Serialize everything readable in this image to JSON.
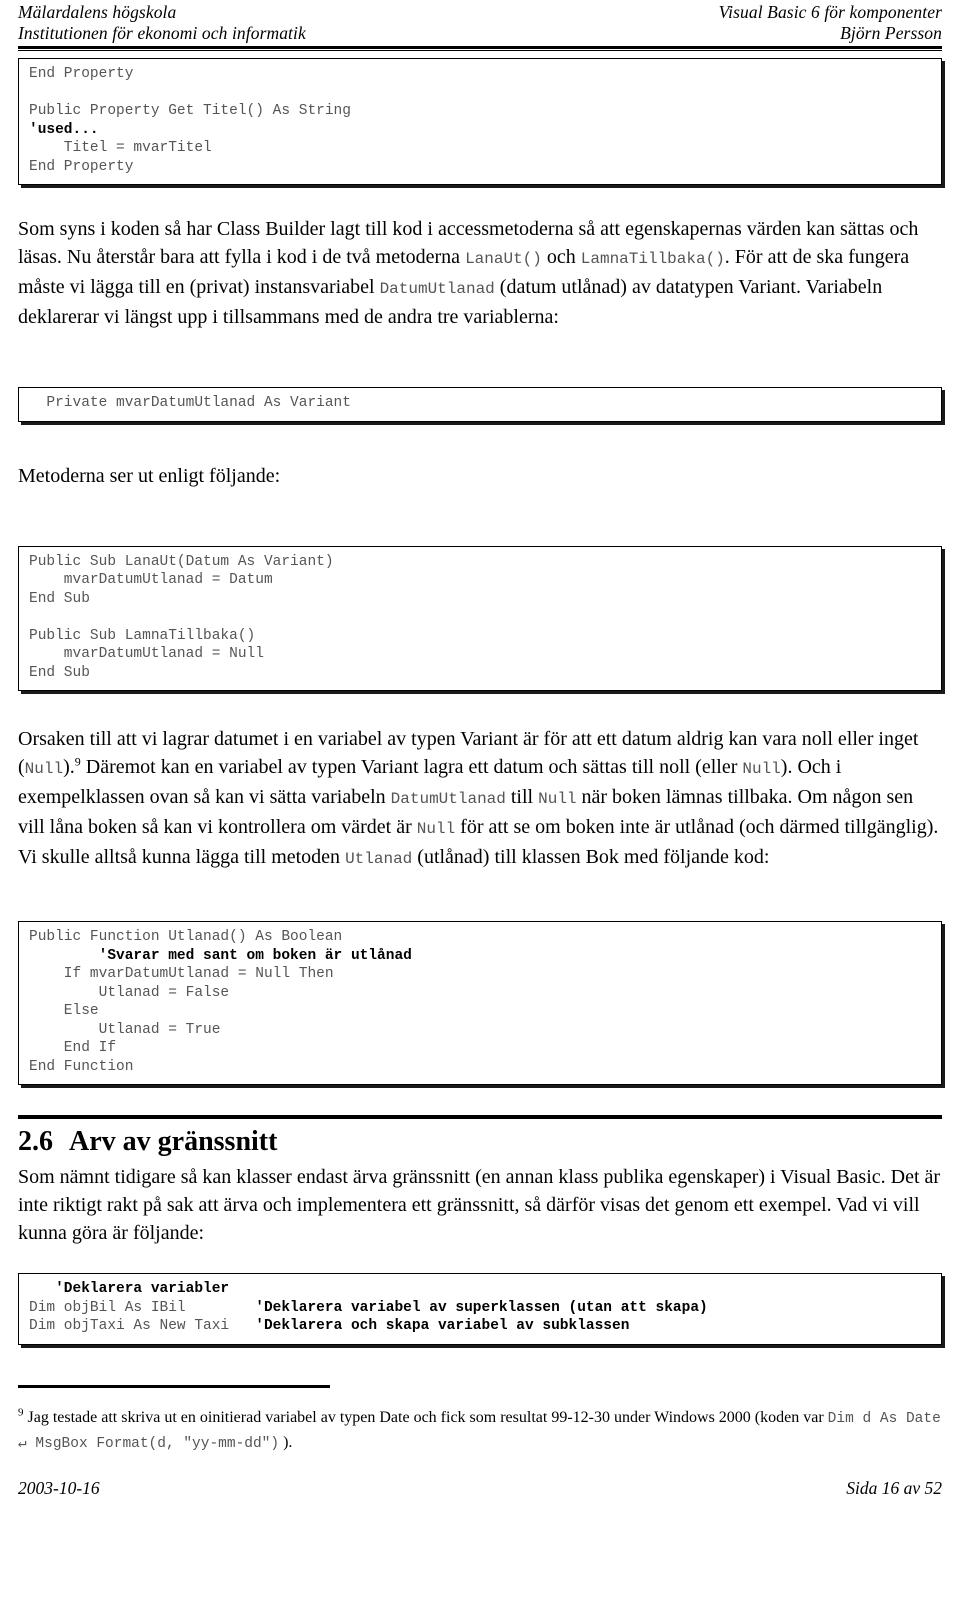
{
  "header": {
    "left_line1": "Mälardalens högskola",
    "left_line2": "Institutionen för ekonomi och informatik",
    "right_line1": "Visual Basic 6 för komponenter",
    "right_line2": "Björn Persson"
  },
  "code_blocks": {
    "block1_pre": "End Property\n\nPublic Property Get Titel() As String\n",
    "block1_bold": "'used...",
    "block1_post": "\n    Titel = mvarTitel\nEnd Property",
    "block2": "  Private mvarDatumUtlanad As Variant",
    "block3": "Public Sub LanaUt(Datum As Variant)\n    mvarDatumUtlanad = Datum\nEnd Sub\n\nPublic Sub LamnaTillbaka()\n    mvarDatumUtlanad = Null\nEnd Sub",
    "block4_l1": "Public Function Utlanad() As Boolean",
    "block4_l2_bold": "        'Svarar med sant om boken är utlånad",
    "block4_rest": "    If mvarDatumUtlanad = Null Then\n        Utlanad = False\n    Else\n        Utlanad = True\n    End If\nEnd Function",
    "block5_l1_bold": "   'Deklarera variabler",
    "block5_l2_code": "Dim objBil As IBil        ",
    "block5_l2_bold": "'Deklarera variabel av superklassen (utan att skapa)",
    "block5_l3_code": "Dim objTaxi As New Taxi   ",
    "block5_l3_bold": "'Deklarera och skapa variabel av subklassen"
  },
  "paragraphs": {
    "p1_a": "Som syns i koden så har Class Builder lagt till kod i accessmetoderna så att egenskapernas värden kan sättas och läsas. Nu återstår bara att fylla i kod i de två metoderna ",
    "p1_code1": "LanaUt()",
    "p1_b": " och ",
    "p1_code2": "LamnaTillbaka()",
    "p1_c": ". För att de ska fungera måste vi lägga till en (privat) instansvariabel ",
    "p1_code3": "DatumUtlanad",
    "p1_d": " (datum utlånad) av datatypen Variant. Variabeln deklarerar vi längst upp i tillsammans med de andra tre variablerna:",
    "p2": "Metoderna ser ut enligt följande:",
    "p3_a": "Orsaken till att vi lagrar datumet i en variabel av typen Variant är för att ett datum aldrig kan vara noll eller inget (",
    "p3_code1": "Null",
    "p3_b": ").",
    "p3_sup": "9",
    "p3_c": " Däremot kan en variabel av typen Variant lagra ett datum och sättas till noll (eller ",
    "p3_code2": "Null",
    "p3_d": "). Och i exempelklassen ovan så kan vi sätta variabeln ",
    "p3_code3": "DatumUtlanad",
    "p3_e": " till ",
    "p3_code4": "Null",
    "p3_f": " när boken lämnas tillbaka. Om någon sen vill låna boken så kan vi kontrollera om värdet är ",
    "p3_code5": "Null",
    "p3_g": " för att se om boken inte är utlånad (och därmed tillgänglig). Vi skulle alltså kunna lägga till metoden ",
    "p3_code6": "Utlanad",
    "p3_h": " (utlånad) till klassen Bok med följande kod:",
    "p4": "Som nämnt tidigare så kan klasser endast ärva gränssnitt (en annan klass publika egenskaper) i Visual Basic. Det är inte riktigt rakt på sak att ärva och implementera ett gränssnitt, så därför visas det genom ett exempel. Vad vi vill kunna göra är följande:"
  },
  "section": {
    "number": "2.6",
    "title": "Arv av gränssnitt"
  },
  "footnote": {
    "marker": "9",
    "text_a": " Jag testade att skriva ut en oinitierad variabel av typen Date och fick som resultat 99-12-30 under Windows 2000 (koden var ",
    "code": "Dim d As Date ↵ MsgBox Format(d, \"yy-mm-dd\")",
    "text_b": " )."
  },
  "footer": {
    "date": "2003-10-16",
    "page": "Sida 16 av 52"
  }
}
